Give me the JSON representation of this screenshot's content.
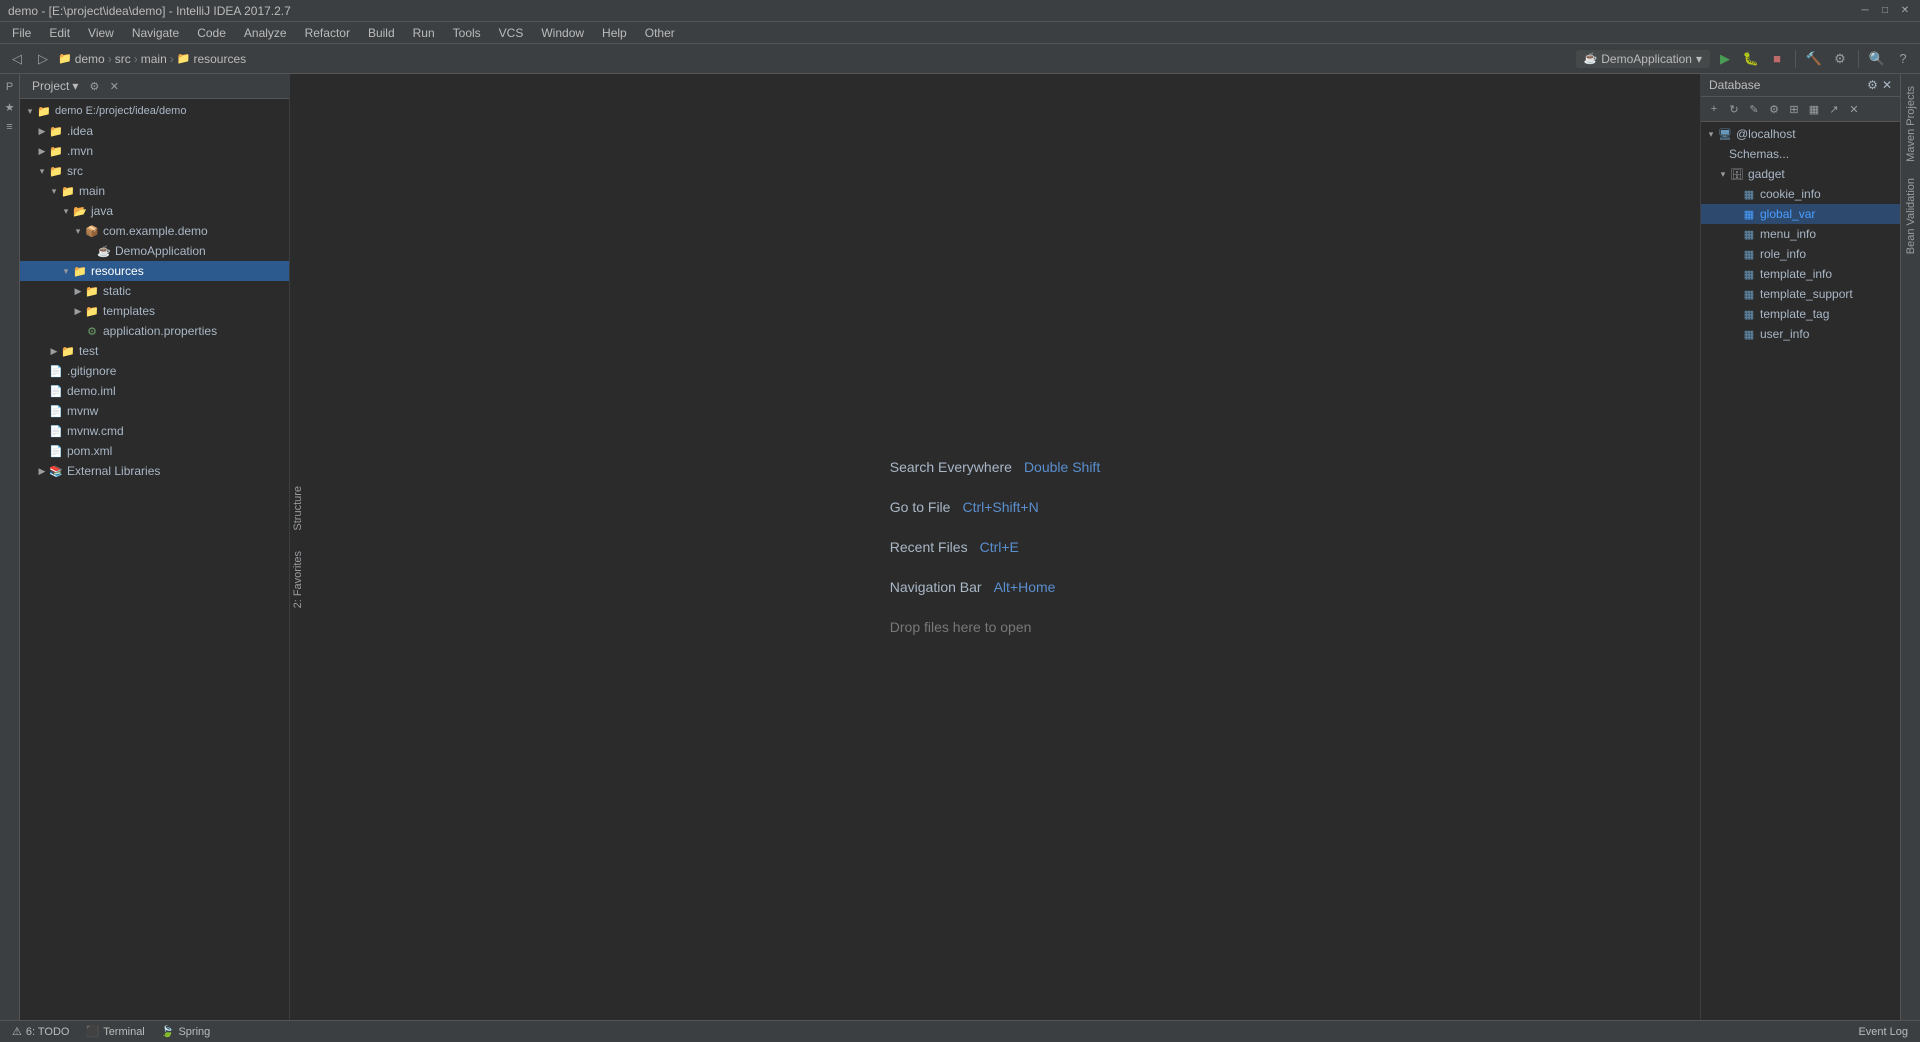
{
  "titleBar": {
    "title": "demo - [E:\\project\\idea\\demo] - IntelliJ IDEA 2017.2.7",
    "minimize": "─",
    "maximize": "□",
    "close": "✕"
  },
  "menuBar": {
    "items": [
      "File",
      "Edit",
      "View",
      "Navigate",
      "Code",
      "Analyze",
      "Refactor",
      "Build",
      "Run",
      "Tools",
      "VCS",
      "Window",
      "Help",
      "Other"
    ]
  },
  "toolbar": {
    "breadcrumb": {
      "project": "demo",
      "src": "src",
      "main": "main",
      "resources": "resources"
    },
    "runConfig": "DemoApplication",
    "dropdownArrow": "▾"
  },
  "projectPanel": {
    "title": "Project",
    "dropdown": "▾",
    "tree": [
      {
        "id": "demo",
        "label": "demo",
        "path": "E:/project/idea/demo",
        "level": 0,
        "type": "module",
        "expanded": true,
        "arrow": "▾"
      },
      {
        "id": "idea",
        "label": ".idea",
        "level": 1,
        "type": "folder",
        "expanded": false,
        "arrow": "▶"
      },
      {
        "id": "mvn",
        "label": ".mvn",
        "level": 1,
        "type": "folder",
        "expanded": false,
        "arrow": "▶"
      },
      {
        "id": "src",
        "label": "src",
        "level": 1,
        "type": "folder",
        "expanded": true,
        "arrow": "▾"
      },
      {
        "id": "main",
        "label": "main",
        "level": 2,
        "type": "folder",
        "expanded": true,
        "arrow": "▾"
      },
      {
        "id": "java",
        "label": "java",
        "level": 3,
        "type": "folder-src",
        "expanded": true,
        "arrow": "▾"
      },
      {
        "id": "com.example.demo",
        "label": "com.example.demo",
        "level": 4,
        "type": "package",
        "expanded": true,
        "arrow": "▾"
      },
      {
        "id": "DemoApplication",
        "label": "DemoApplication",
        "level": 5,
        "type": "class",
        "arrow": ""
      },
      {
        "id": "resources",
        "label": "resources",
        "level": 3,
        "type": "folder-res",
        "expanded": true,
        "arrow": "▾",
        "selected": true
      },
      {
        "id": "static",
        "label": "static",
        "level": 4,
        "type": "folder",
        "expanded": false,
        "arrow": "▶"
      },
      {
        "id": "templates",
        "label": "templates",
        "level": 4,
        "type": "folder",
        "expanded": false,
        "arrow": "▶"
      },
      {
        "id": "application.properties",
        "label": "application.properties",
        "level": 4,
        "type": "props",
        "arrow": ""
      },
      {
        "id": "test",
        "label": "test",
        "level": 2,
        "type": "folder",
        "expanded": false,
        "arrow": "▶"
      },
      {
        "id": ".gitignore",
        "label": ".gitignore",
        "level": 1,
        "type": "file",
        "arrow": ""
      },
      {
        "id": "demo.iml",
        "label": "demo.iml",
        "level": 1,
        "type": "iml",
        "arrow": ""
      },
      {
        "id": "mvnw",
        "label": "mvnw",
        "level": 1,
        "type": "file",
        "arrow": ""
      },
      {
        "id": "mvnw.cmd",
        "label": "mvnw.cmd",
        "level": 1,
        "type": "file",
        "arrow": ""
      },
      {
        "id": "pom.xml",
        "label": "pom.xml",
        "level": 1,
        "type": "xml",
        "arrow": ""
      },
      {
        "id": "ExternalLibraries",
        "label": "External Libraries",
        "level": 1,
        "type": "ext-lib",
        "expanded": false,
        "arrow": "▶"
      }
    ]
  },
  "editorArea": {
    "searchEverywhere": {
      "label": "Search Everywhere",
      "shortcut": "Double Shift"
    },
    "goToFile": {
      "label": "Go to File",
      "shortcut": "Ctrl+Shift+N"
    },
    "recentFiles": {
      "label": "Recent Files",
      "shortcut": "Ctrl+E"
    },
    "navigationBar": {
      "label": "Navigation Bar",
      "shortcut": "Alt+Home"
    },
    "dropFiles": {
      "label": "Drop files here to open"
    }
  },
  "dbPanel": {
    "title": "Database",
    "toolbarBtns": [
      "+",
      "↻",
      "✎",
      "⚙",
      "⊞",
      "▦",
      "↗",
      "✕"
    ],
    "tree": [
      {
        "id": "localhost",
        "label": "@localhost",
        "level": 0,
        "type": "server",
        "expanded": true,
        "arrow": "▾"
      },
      {
        "id": "schemas",
        "label": "Schemas...",
        "level": 1,
        "type": "schema-label",
        "arrow": ""
      },
      {
        "id": "gadget",
        "label": "gadget",
        "level": 1,
        "type": "schema",
        "expanded": true,
        "arrow": "▾"
      },
      {
        "id": "cookie_info",
        "label": "cookie_info",
        "level": 2,
        "type": "table",
        "arrow": ""
      },
      {
        "id": "global_var",
        "label": "global_var",
        "level": 2,
        "type": "table",
        "highlighted": true,
        "arrow": ""
      },
      {
        "id": "menu_info",
        "label": "menu_info",
        "level": 2,
        "type": "table",
        "arrow": ""
      },
      {
        "id": "role_info",
        "label": "role_info",
        "level": 2,
        "type": "table",
        "arrow": ""
      },
      {
        "id": "template_info",
        "label": "template_info",
        "level": 2,
        "type": "table",
        "arrow": ""
      },
      {
        "id": "template_support",
        "label": "template_support",
        "level": 2,
        "type": "table",
        "arrow": ""
      },
      {
        "id": "template_tag",
        "label": "template_tag",
        "level": 2,
        "type": "table",
        "arrow": ""
      },
      {
        "id": "user_info",
        "label": "user_info",
        "level": 2,
        "type": "table",
        "arrow": ""
      }
    ]
  },
  "statusBar": {
    "todo": "6: TODO",
    "terminal": "Terminal",
    "spring": "Spring",
    "eventLog": "Event Log"
  },
  "rightSideTabs": [
    "Maven Projects",
    "Validation"
  ],
  "leftSideTabs": [
    "Structure",
    "Favorites"
  ]
}
